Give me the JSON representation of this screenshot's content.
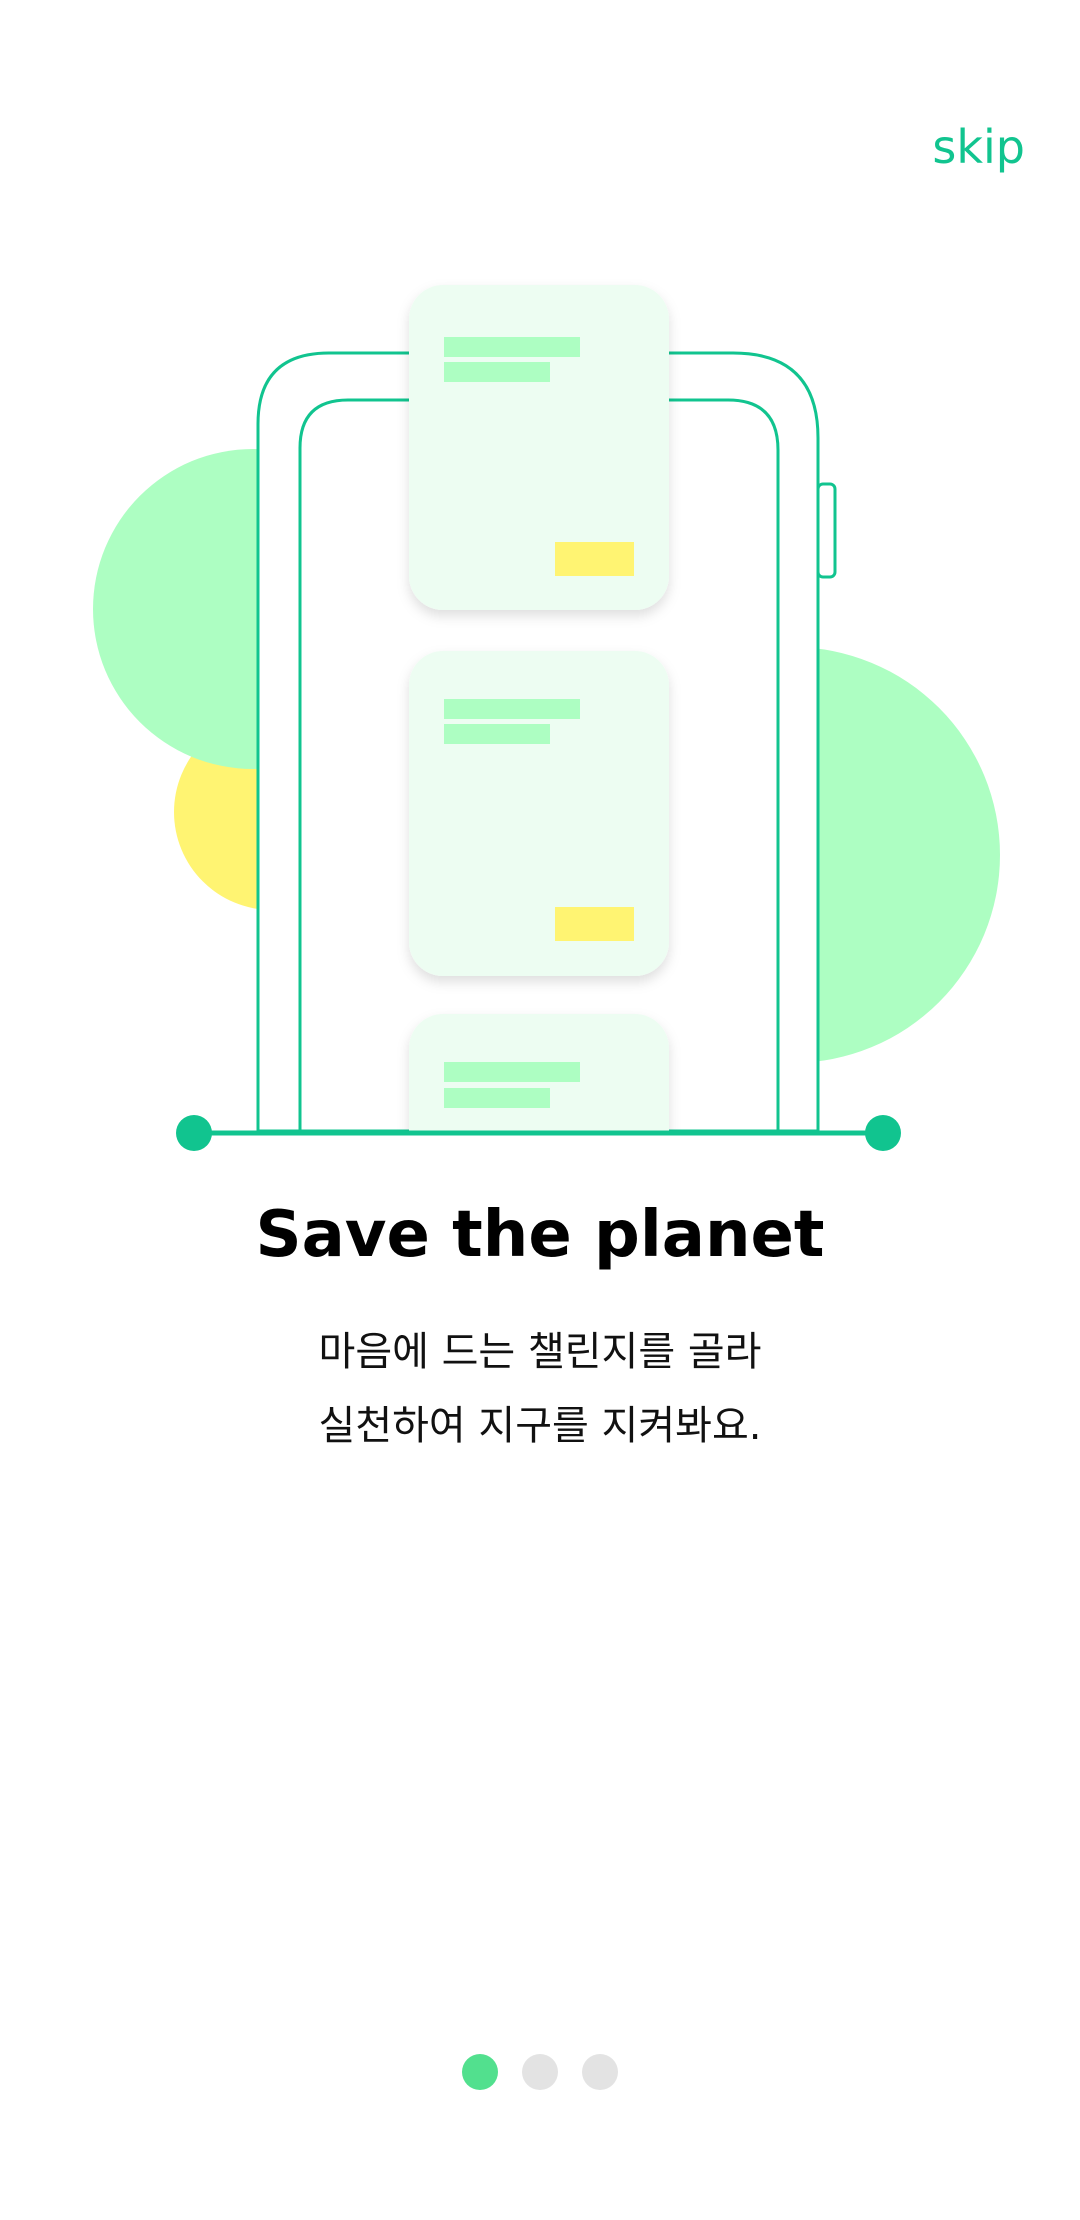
{
  "skip": {
    "label": "skip"
  },
  "onboarding": {
    "title": "Save the planet",
    "description_line1": "마음에 드는 챌린지를 골라",
    "description_line2": "실천하여 지구를 지켜봐요."
  },
  "pagination": {
    "total": 3,
    "active_index": 0
  },
  "colors": {
    "accent": "#11c48f",
    "light_green": "#adfec2",
    "card_bg": "#edfdf2",
    "yellow": "#fff472",
    "dot_active": "#52e08e",
    "dot_inactive": "#e3e3e3"
  }
}
